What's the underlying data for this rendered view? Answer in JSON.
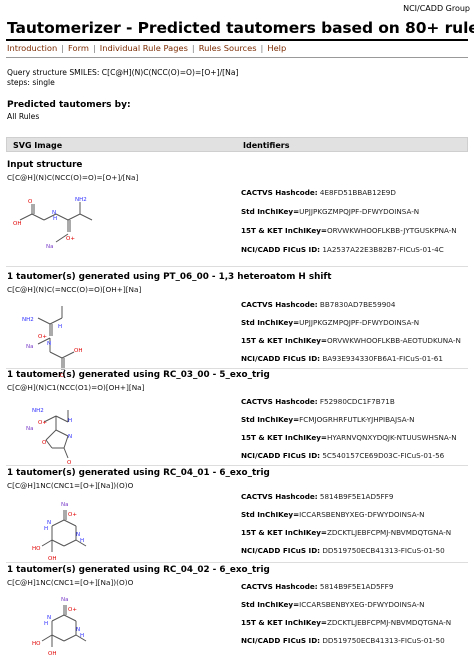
{
  "header": {
    "org": "NCI/CADD Group",
    "title": "Tautomerizer - Predicted tautomers based on 80+ rules"
  },
  "nav": [
    {
      "label": "Introduction"
    },
    {
      "label": "Form"
    },
    {
      "label": "Individual Rule Pages"
    },
    {
      "label": "Rules Sources"
    },
    {
      "label": "Help"
    }
  ],
  "query": {
    "line1": "Query structure SMILES: C[C@H](N)C(NCC(O)=O)=[O+]/[Na]",
    "line2": "steps: single"
  },
  "predicted": {
    "heading": "Predicted tautomers by:",
    "sub": "All Rules"
  },
  "table": {
    "col1": "SVG Image",
    "col2": "Identifiers"
  },
  "blocks": [
    {
      "title": "Input structure",
      "smiles": "C[C@H](N)C(NCC(O)=O)=[O+]/[Na]",
      "ids": [
        {
          "label": "CACTVS Hashcode:",
          "value": "4E8FD51BBAB12E9D"
        },
        {
          "label": "Std InChIKey=",
          "value": "UPJJPKGZMPQJPF-DFWYDOINSA-N"
        },
        {
          "label": "15T & KET InChIKey=",
          "value": "ORVWKWHOOFLKBB-JYTGUSKPNA-N"
        },
        {
          "label": "NCI/CADD FICuS ID:",
          "value": "1A2537A22E3B82B7-FICuS-01-4C"
        }
      ]
    },
    {
      "title": "1 tautomer(s) generated using PT_06_00 - 1,3 heteroatom H shift",
      "smiles": "C[C@H](N)C(=NCC(O)=O)[OH+][Na]",
      "ids": [
        {
          "label": "CACTVS Hashcode:",
          "value": "BB7830AD7BE59904"
        },
        {
          "label": "Std InChIKey=",
          "value": "UPJJPKGZMPQJPF-DFWYDOINSA-N"
        },
        {
          "label": "15T & KET InChIKey=",
          "value": "ORVWKWHOOFLKBB-AEOTUDKUNA-N"
        },
        {
          "label": "NCI/CADD FICuS ID:",
          "value": "BA93E934330FB6A1-FICuS-01-61"
        }
      ]
    },
    {
      "title": "1 tautomer(s) generated using RC_03_00 - 5_exo_trig",
      "smiles": "C[C@H](N)C1(NCC(O1)=O)[OH+][Na]",
      "ids": [
        {
          "label": "CACTVS Hashcode:",
          "value": "F52980CDC1F7B71B"
        },
        {
          "label": "Std InChIKey=",
          "value": "FCMJOGRHRFUTLK-YJHPIBAJSA-N"
        },
        {
          "label": "15T & KET InChIKey=",
          "value": "HYARNVQNXYDQJK-NTUUSWHSNA-N"
        },
        {
          "label": "NCI/CADD FICuS ID:",
          "value": "5C540157CE69D03C-FICuS-01-56"
        }
      ]
    },
    {
      "title": "1 tautomer(s) generated using RC_04_01 - 6_exo_trig",
      "smiles": "C[C@H]1NC(CNC1=[O+][Na])(O)O",
      "ids": [
        {
          "label": "CACTVS Hashcode:",
          "value": "5814B9F5E1AD5FF9"
        },
        {
          "label": "Std InChIKey=",
          "value": "ICCARSBENBYXEG-DFWYDOINSA-N"
        },
        {
          "label": "15T & KET InChIKey=",
          "value": "ZDCKTLJEBFCPMJ-NBVMDQTGNA-N"
        },
        {
          "label": "NCI/CADD FICuS ID:",
          "value": "DD519750ECB41313-FICuS-01-50"
        }
      ]
    },
    {
      "title": "1 tautomer(s) generated using RC_04_02 - 6_exo_trig",
      "smiles": "C[C@H]1NC(CNC1=[O+][Na])(O)O",
      "ids": [
        {
          "label": "CACTVS Hashcode:",
          "value": "5814B9F5E1AD5FF9"
        },
        {
          "label": "Std InChIKey=",
          "value": "ICCARSBENBYXEG-DFWYDOINSA-N"
        },
        {
          "label": "15T & KET InChIKey=",
          "value": "ZDCKTLJEBFCPMJ-NBVMDQTGNA-N"
        },
        {
          "label": "NCI/CADD FICuS ID:",
          "value": "DD519750ECB41313-FICuS-01-50"
        }
      ]
    }
  ],
  "mol_labels": {
    "m0": [
      "O",
      "OH",
      "N",
      "H",
      "NH2",
      "Na",
      "O+"
    ],
    "m1": [
      "NH2",
      "Na",
      "O+",
      "H",
      "N",
      "OH",
      "O"
    ],
    "m2": [
      "NH2",
      "Na",
      "O+",
      "H",
      "N",
      "O",
      "O"
    ],
    "m3": [
      "Na",
      "O+",
      "N",
      "H",
      "N",
      "H",
      "HO",
      "OH"
    ],
    "m4": [
      "Na",
      "O+",
      "N",
      "H",
      "N",
      "H",
      "HO",
      "OH"
    ]
  },
  "colors": {
    "nav_link": "#7a2a00",
    "table_header": "#e1e1e1",
    "atom_N": "#2f2fff",
    "atom_O": "#e00000",
    "atom_Na": "#7a3cc8"
  }
}
